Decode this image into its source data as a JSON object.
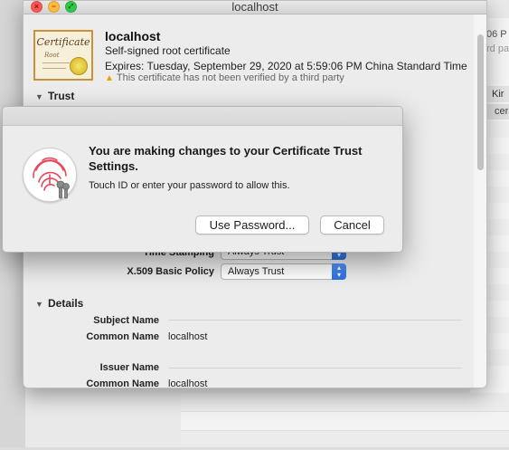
{
  "window": {
    "title": "localhost"
  },
  "certificate": {
    "icon_text": "Certificate",
    "icon_subtext": "Root",
    "name": "localhost",
    "type": "Self-signed root certificate",
    "expires": "Expires: Tuesday, September 29, 2020 at 5:59:06 PM China Standard Time",
    "warning": "This certificate has not been verified by a third party"
  },
  "trust": {
    "section_label": "Trust",
    "rows": [
      {
        "label": "Time Stamping",
        "value": "Always Trust"
      },
      {
        "label": "X.509 Basic Policy",
        "value": "Always Trust"
      }
    ]
  },
  "details": {
    "section_label": "Details",
    "subject_heading": "Subject Name",
    "subject_common_name_label": "Common Name",
    "subject_common_name": "localhost",
    "issuer_heading": "Issuer Name",
    "issuer_common_name_label": "Common Name",
    "issuer_common_name": "localhost"
  },
  "dialog": {
    "heading": "You are making changes to your Certificate Trust Settings.",
    "message": "Touch ID or enter your password to allow this.",
    "use_password_button": "Use Password...",
    "cancel_button": "Cancel"
  },
  "background_app": {
    "partial_text_1": "06 P",
    "partial_text_2": "rd pa",
    "column_header": "Kir",
    "cell_text": "cer"
  },
  "colors": {
    "accent": "#2d6fe0",
    "touch_id": "#e8475a"
  }
}
